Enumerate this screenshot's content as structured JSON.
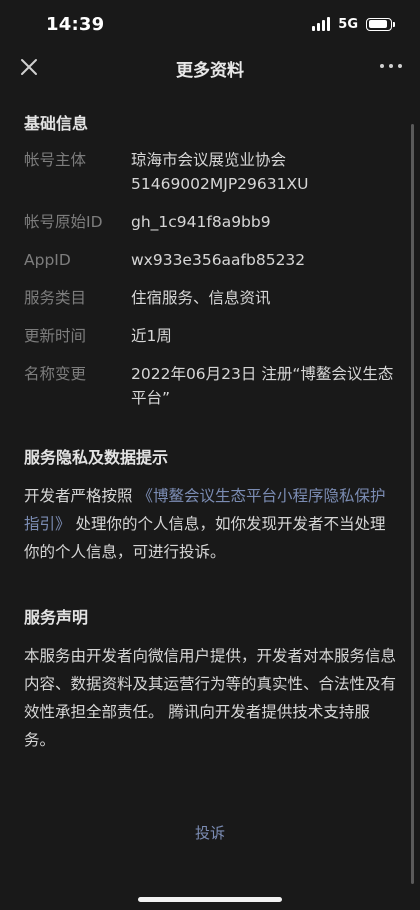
{
  "status_bar": {
    "time": "14:39",
    "network": "5G",
    "battery_level": 0.9
  },
  "nav": {
    "title": "更多资料",
    "close_icon": "close-icon",
    "more_icon": "more-icon"
  },
  "basic_info": {
    "title": "基础信息",
    "rows": [
      {
        "label": "帐号主体",
        "value": "琼海市会议展览业协会\n51469002MJP29631XU"
      },
      {
        "label": "帐号原始ID",
        "value": "gh_1c941f8a9bb9"
      },
      {
        "label": "AppID",
        "value": "wx933e356aafb85232"
      },
      {
        "label": "服务类目",
        "value": "住宿服务、信息资讯"
      },
      {
        "label": "更新时间",
        "value": "近1周"
      },
      {
        "label": "名称变更",
        "value": "2022年06月23日 注册“博鳌会议生态平台”"
      }
    ]
  },
  "privacy": {
    "title": "服务隐私及数据提示",
    "text_before": "开发者严格按照 ",
    "link": "《博鳌会议生态平台小程序隐私保护指引》",
    "text_after": " 处理你的个人信息，如你发现开发者不当处理你的个人信息，可进行投诉。"
  },
  "statement": {
    "title": "服务声明",
    "text": "本服务由开发者向微信用户提供，开发者对本服务信息内容、数据资料及其运营行为等的真实性、合法性及有效性承担全部责任。 腾讯向开发者提供技术支持服务。"
  },
  "complain_label": "投诉",
  "colors": {
    "background": "#191919",
    "link": "#7b8cb3",
    "label": "#7d7d7d"
  }
}
